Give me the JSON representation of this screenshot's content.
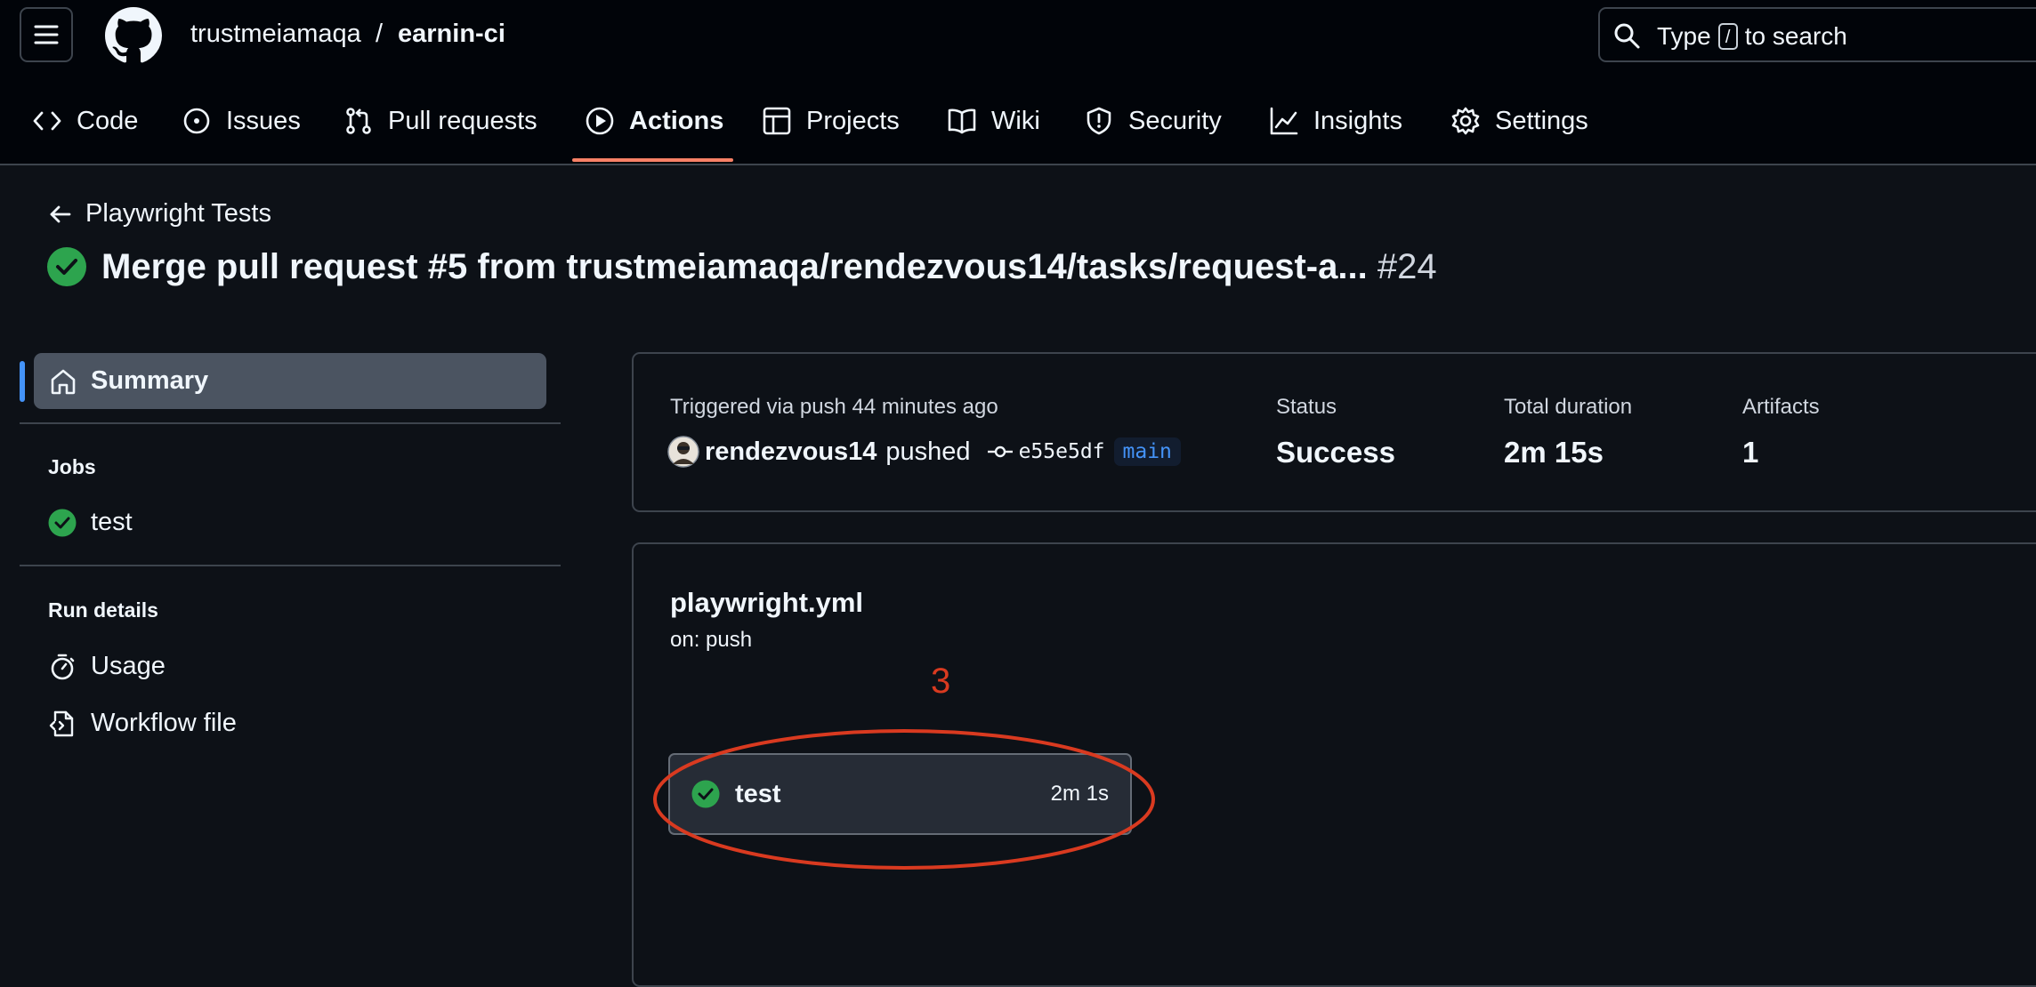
{
  "header": {
    "owner": "trustmeiamaqa",
    "separator": "/",
    "repo": "earnin-ci",
    "search": {
      "prefix": "Type",
      "key": "/",
      "suffix": "to search"
    }
  },
  "tabs": [
    {
      "label": "Code",
      "icon": "code-icon"
    },
    {
      "label": "Issues",
      "icon": "issue-icon"
    },
    {
      "label": "Pull requests",
      "icon": "pull-request-icon"
    },
    {
      "label": "Actions",
      "icon": "play-icon",
      "active": true
    },
    {
      "label": "Projects",
      "icon": "table-icon"
    },
    {
      "label": "Wiki",
      "icon": "book-icon"
    },
    {
      "label": "Security",
      "icon": "shield-icon"
    },
    {
      "label": "Insights",
      "icon": "graph-icon"
    },
    {
      "label": "Settings",
      "icon": "gear-icon"
    }
  ],
  "page": {
    "back_label": "Playwright Tests",
    "title": "Merge pull request #5 from trustmeiamaqa/rendezvous14/tasks/request-a...",
    "run_number": "#24"
  },
  "sidebar": {
    "summary": "Summary",
    "jobs_heading": "Jobs",
    "jobs": [
      {
        "label": "test"
      }
    ],
    "run_details_heading": "Run details",
    "run_details": [
      {
        "label": "Usage",
        "icon": "stopwatch-icon"
      },
      {
        "label": "Workflow file",
        "icon": "file-code-icon"
      }
    ]
  },
  "summary_card": {
    "trigger": "Triggered via push 44 minutes ago",
    "actor": "rendezvous14",
    "action": "pushed",
    "commit": "e55e5df",
    "branch": "main",
    "status_label": "Status",
    "status_value": "Success",
    "duration_label": "Total duration",
    "duration_value": "2m 15s",
    "artifacts_label": "Artifacts",
    "artifacts_value": "1"
  },
  "workflow": {
    "file": "playwright.yml",
    "trigger": "on: push",
    "job": {
      "name": "test",
      "duration": "2m 1s"
    }
  },
  "annotation": {
    "number": "3",
    "color": "#d93a20"
  },
  "colors": {
    "success": "#2da44e",
    "accent": "#4493f8",
    "tab_underline": "#f78166"
  }
}
